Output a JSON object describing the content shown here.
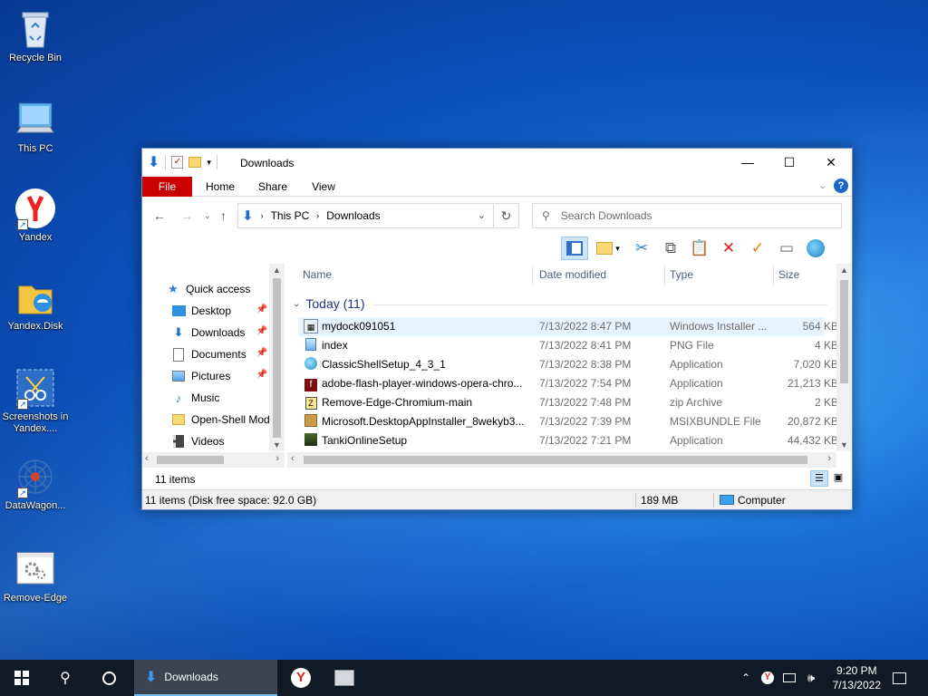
{
  "desktop": {
    "icons": [
      {
        "label": "Recycle Bin"
      },
      {
        "label": "This PC"
      },
      {
        "label": "Yandex"
      },
      {
        "label": "Yandex.Disk"
      },
      {
        "label": "Screenshots in Yandex...."
      },
      {
        "label": "DataWagon..."
      },
      {
        "label": "Remove-Edge"
      }
    ]
  },
  "window": {
    "title": "Downloads",
    "ribbon_tabs": [
      "File",
      "Home",
      "Share",
      "View"
    ],
    "address": {
      "crumbs": [
        "This PC",
        "Downloads"
      ]
    },
    "search": {
      "placeholder": "Search Downloads"
    },
    "nav_pane": [
      {
        "label": "Quick access",
        "icon": "star-icon",
        "pinned": false
      },
      {
        "label": "Desktop",
        "icon": "desktop-icon",
        "pinned": true
      },
      {
        "label": "Downloads",
        "icon": "download-icon",
        "pinned": true
      },
      {
        "label": "Documents",
        "icon": "document-icon",
        "pinned": true
      },
      {
        "label": "Pictures",
        "icon": "picture-icon",
        "pinned": true
      },
      {
        "label": "Music",
        "icon": "music-icon",
        "pinned": false
      },
      {
        "label": "Open-Shell Mod",
        "icon": "folder-icon",
        "pinned": false
      },
      {
        "label": "Videos",
        "icon": "video-icon",
        "pinned": false
      }
    ],
    "columns": {
      "name": "Name",
      "date": "Date modified",
      "type": "Type",
      "size": "Size"
    },
    "group": {
      "label": "Today (11)"
    },
    "files": [
      {
        "name": "mydock091051",
        "date": "7/13/2022 8:47 PM",
        "type": "Windows Installer ...",
        "size": "564 KB",
        "selected": true
      },
      {
        "name": "index",
        "date": "7/13/2022 8:41 PM",
        "type": "PNG File",
        "size": "4 KB"
      },
      {
        "name": "ClassicShellSetup_4_3_1",
        "date": "7/13/2022 8:38 PM",
        "type": "Application",
        "size": "7,020 KB"
      },
      {
        "name": "adobe-flash-player-windows-opera-chro...",
        "date": "7/13/2022 7:54 PM",
        "type": "Application",
        "size": "21,213 KB"
      },
      {
        "name": "Remove-Edge-Chromium-main",
        "date": "7/13/2022 7:48 PM",
        "type": "zip Archive",
        "size": "2 KB"
      },
      {
        "name": "Microsoft.DesktopAppInstaller_8wekyb3...",
        "date": "7/13/2022 7:39 PM",
        "type": "MSIXBUNDLE File",
        "size": "20,872 KB"
      },
      {
        "name": "TankiOnlineSetup",
        "date": "7/13/2022 7:21 PM",
        "type": "Application",
        "size": "44,432 KB"
      }
    ],
    "item_count": "11 items",
    "status": {
      "left": "11 items (Disk free space: 92.0 GB)",
      "size": "189 MB",
      "location": "Computer"
    }
  },
  "taskbar": {
    "active_app": "Downloads",
    "time": "9:20 PM",
    "date": "7/13/2022"
  }
}
